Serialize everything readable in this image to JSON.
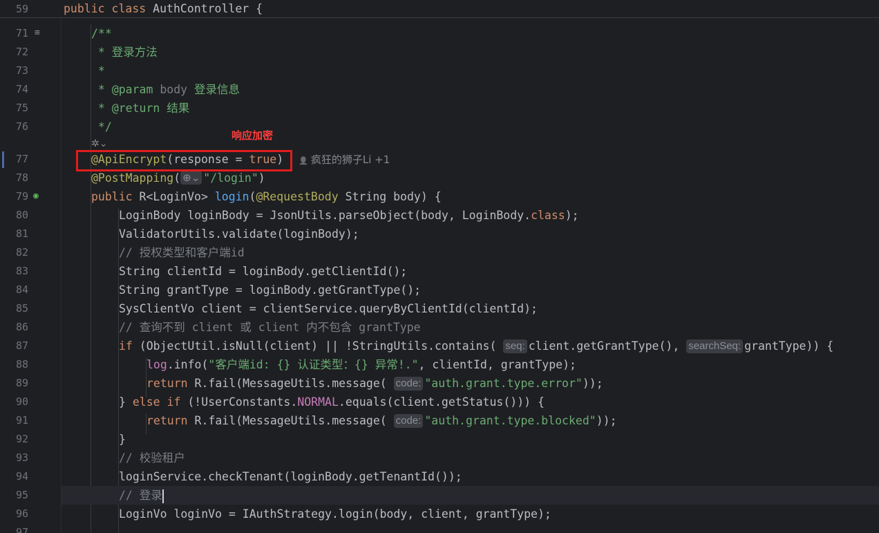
{
  "sticky": {
    "line_number": "59",
    "tokens": [
      {
        "t": "public class ",
        "c": "k"
      },
      {
        "t": "AuthController",
        "c": "t"
      },
      {
        "t": " {",
        "c": "t"
      }
    ]
  },
  "annotation_box": {
    "label": "响应加密"
  },
  "author_hint": {
    "icon": "person-icon",
    "text": "疯狂的狮子Li +1"
  },
  "lines": [
    {
      "n": "71",
      "indent": 1,
      "tokens": [
        {
          "t": "/**",
          "c": "doc"
        }
      ]
    },
    {
      "n": "72",
      "indent": 1,
      "tokens": [
        {
          "t": " * 登录方法",
          "c": "doc"
        }
      ]
    },
    {
      "n": "73",
      "indent": 1,
      "tokens": [
        {
          "t": " *",
          "c": "doc"
        }
      ]
    },
    {
      "n": "74",
      "indent": 1,
      "tokens": [
        {
          "t": " * ",
          "c": "doc"
        },
        {
          "t": "@param",
          "c": "doc"
        },
        {
          "t": " body ",
          "c": "cmt"
        },
        {
          "t": "登录信息",
          "c": "doc"
        }
      ]
    },
    {
      "n": "75",
      "indent": 1,
      "tokens": [
        {
          "t": " * ",
          "c": "doc"
        },
        {
          "t": "@return",
          "c": "doc"
        },
        {
          "t": " 结果",
          "c": "doc"
        }
      ]
    },
    {
      "n": "76",
      "indent": 1,
      "tokens": [
        {
          "t": " */",
          "c": "doc"
        }
      ]
    },
    {
      "n": "",
      "indent": 1,
      "tokens": []
    },
    {
      "n": "77",
      "indent": 1,
      "tokens": [
        {
          "t": "@ApiEncrypt",
          "c": "ann"
        },
        {
          "t": "(response = ",
          "c": "t"
        },
        {
          "t": "true",
          "c": "k"
        },
        {
          "t": ")",
          "c": "t"
        }
      ]
    },
    {
      "n": "78",
      "indent": 1,
      "tokens": [
        {
          "t": "@PostMapping",
          "c": "ann"
        },
        {
          "t": "(",
          "c": "t"
        },
        {
          "t": "⊕⌄",
          "c": "hintg"
        },
        {
          "t": "\"/login\"",
          "c": "str"
        },
        {
          "t": ")",
          "c": "t"
        }
      ]
    },
    {
      "n": "79",
      "indent": 1,
      "tokens": [
        {
          "t": "public ",
          "c": "k"
        },
        {
          "t": "R<LoginVo> ",
          "c": "t"
        },
        {
          "t": "login",
          "c": "fn"
        },
        {
          "t": "(",
          "c": "t"
        },
        {
          "t": "@RequestBody",
          "c": "ann"
        },
        {
          "t": " String body) {",
          "c": "t"
        }
      ]
    },
    {
      "n": "80",
      "indent": 2,
      "tokens": [
        {
          "t": "LoginBody loginBody = JsonUtils.",
          "c": "t"
        },
        {
          "t": "parseObject",
          "c": "t"
        },
        {
          "t": "(body, LoginBody.",
          "c": "t"
        },
        {
          "t": "class",
          "c": "k"
        },
        {
          "t": ");",
          "c": "t"
        }
      ]
    },
    {
      "n": "81",
      "indent": 2,
      "tokens": [
        {
          "t": "ValidatorUtils.",
          "c": "t"
        },
        {
          "t": "validate",
          "c": "t"
        },
        {
          "t": "(loginBody);",
          "c": "t"
        }
      ]
    },
    {
      "n": "82",
      "indent": 2,
      "tokens": [
        {
          "t": "// 授权类型和客户端id",
          "c": "cmt"
        }
      ]
    },
    {
      "n": "83",
      "indent": 2,
      "tokens": [
        {
          "t": "String clientId = loginBody.",
          "c": "t"
        },
        {
          "t": "getClientId",
          "c": "t"
        },
        {
          "t": "();",
          "c": "t"
        }
      ]
    },
    {
      "n": "84",
      "indent": 2,
      "tokens": [
        {
          "t": "String grantType = loginBody.getGrantType();",
          "c": "t"
        }
      ]
    },
    {
      "n": "85",
      "indent": 2,
      "tokens": [
        {
          "t": "SysClientVo client = clientService.queryByClientId(clientId);",
          "c": "t"
        }
      ]
    },
    {
      "n": "86",
      "indent": 2,
      "tokens": [
        {
          "t": "// 查询不到 client 或 client 内不包含 grantType",
          "c": "cmt"
        }
      ]
    },
    {
      "n": "87",
      "indent": 2,
      "tokens": [
        {
          "t": "if",
          "c": "k"
        },
        {
          "t": " (ObjectUtil.",
          "c": "t"
        },
        {
          "t": "isNull",
          "c": "t"
        },
        {
          "t": "(client) || !StringUtils.",
          "c": "t"
        },
        {
          "t": "contains",
          "c": "t"
        },
        {
          "t": "( ",
          "c": "t"
        },
        {
          "t": "seq:",
          "c": "hint"
        },
        {
          "t": "client.getGrantType(), ",
          "c": "t"
        },
        {
          "t": "searchSeq:",
          "c": "hint"
        },
        {
          "t": "grantType)) {",
          "c": "t"
        }
      ]
    },
    {
      "n": "88",
      "indent": 3,
      "tokens": [
        {
          "t": "log",
          "c": "fld"
        },
        {
          "t": ".info(",
          "c": "t"
        },
        {
          "t": "\"客户端id: {} 认证类型：{} 异常!.\"",
          "c": "str"
        },
        {
          "t": ", clientId, grantType);",
          "c": "t"
        }
      ]
    },
    {
      "n": "89",
      "indent": 3,
      "tokens": [
        {
          "t": "return ",
          "c": "k"
        },
        {
          "t": "R.",
          "c": "t"
        },
        {
          "t": "fail",
          "c": "t"
        },
        {
          "t": "(MessageUtils.",
          "c": "t"
        },
        {
          "t": "message",
          "c": "t"
        },
        {
          "t": "( ",
          "c": "t"
        },
        {
          "t": "code:",
          "c": "hint"
        },
        {
          "t": "\"auth.grant.type.error\"",
          "c": "str"
        },
        {
          "t": "));",
          "c": "t"
        }
      ]
    },
    {
      "n": "90",
      "indent": 2,
      "tokens": [
        {
          "t": "} ",
          "c": "t"
        },
        {
          "t": "else if",
          "c": "k"
        },
        {
          "t": " (!UserConstants.",
          "c": "t"
        },
        {
          "t": "NORMAL",
          "c": "fld"
        },
        {
          "t": ".equals(client.getStatus())) {",
          "c": "t"
        }
      ]
    },
    {
      "n": "91",
      "indent": 3,
      "tokens": [
        {
          "t": "return ",
          "c": "k"
        },
        {
          "t": "R.",
          "c": "t"
        },
        {
          "t": "fail",
          "c": "t"
        },
        {
          "t": "(MessageUtils.",
          "c": "t"
        },
        {
          "t": "message",
          "c": "t"
        },
        {
          "t": "( ",
          "c": "t"
        },
        {
          "t": "code:",
          "c": "hint"
        },
        {
          "t": "\"auth.grant.type.blocked\"",
          "c": "str"
        },
        {
          "t": "));",
          "c": "t"
        }
      ]
    },
    {
      "n": "92",
      "indent": 2,
      "tokens": [
        {
          "t": "}",
          "c": "t"
        }
      ]
    },
    {
      "n": "93",
      "indent": 2,
      "tokens": [
        {
          "t": "// 校验租户",
          "c": "cmt"
        }
      ]
    },
    {
      "n": "94",
      "indent": 2,
      "tokens": [
        {
          "t": "loginService.checkTenant(loginBody.getTenantId());",
          "c": "t"
        }
      ]
    },
    {
      "n": "95",
      "indent": 2,
      "tokens": [
        {
          "t": "// 登录",
          "c": "cmt"
        }
      ]
    },
    {
      "n": "96",
      "indent": 2,
      "tokens": [
        {
          "t": "LoginVo loginVo = IAuthStrategy.",
          "c": "t"
        },
        {
          "t": "login",
          "c": "t"
        },
        {
          "t": "(body, client, grantType);",
          "c": "t"
        }
      ]
    },
    {
      "n": "97",
      "indent": 2,
      "tokens": []
    }
  ]
}
